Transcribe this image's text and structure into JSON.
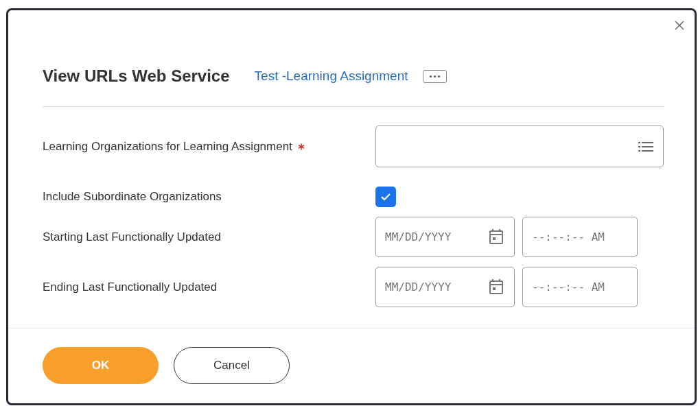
{
  "dialog": {
    "title": "View URLs Web Service",
    "subtitle_link": "Test -Learning Assignment",
    "fields": [
      {
        "kind": "prompt",
        "label": "Learning Organizations for Learning Assignment",
        "required": true
      },
      {
        "kind": "checkbox",
        "label": "Include Subordinate Organizations",
        "checked": true
      },
      {
        "kind": "datetime",
        "label": "Starting Last Functionally Updated",
        "date_placeholder": "MM/DD/YYYY",
        "time_placeholder": "--:--:-- AM"
      },
      {
        "kind": "datetime",
        "label": "Ending Last Functionally Updated",
        "date_placeholder": "MM/DD/YYYY",
        "time_placeholder": "--:--:-- AM"
      }
    ],
    "buttons": [
      {
        "label": "OK",
        "kind": "primary"
      },
      {
        "label": "Cancel",
        "kind": "secondary"
      }
    ]
  }
}
